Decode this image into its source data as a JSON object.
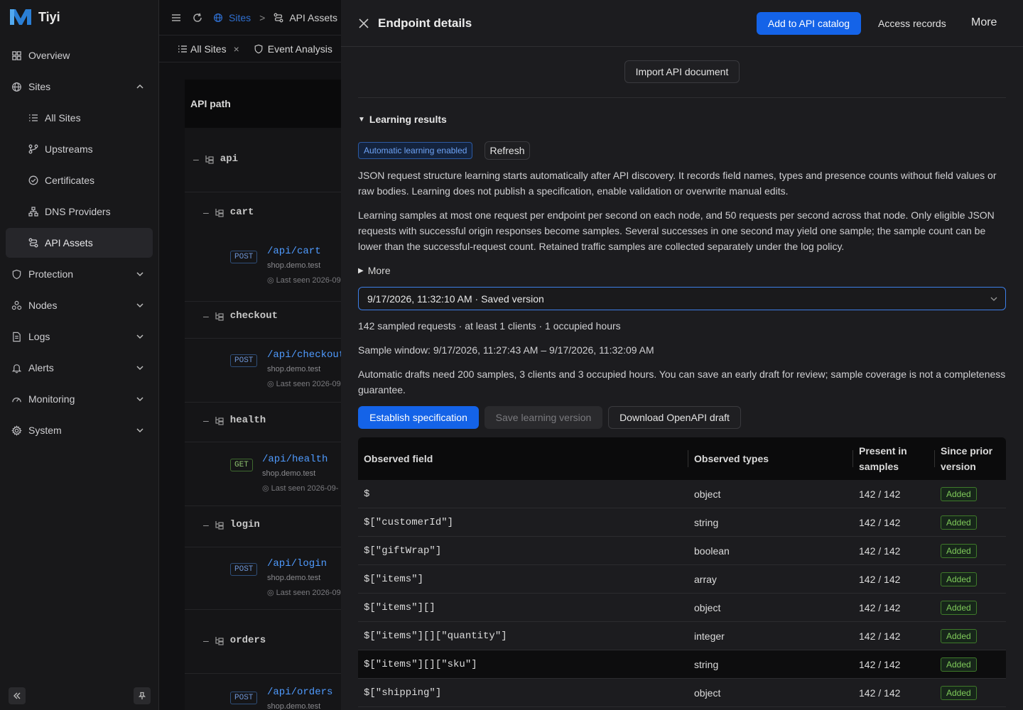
{
  "app": {
    "name": "Tiyi"
  },
  "sidebar": {
    "items": [
      {
        "label": "Overview",
        "icon": "grid-icon"
      },
      {
        "label": "Sites",
        "icon": "globe-icon",
        "expanded": true
      },
      {
        "label": "All Sites",
        "icon": "list-icon"
      },
      {
        "label": "Upstreams",
        "icon": "branch-icon"
      },
      {
        "label": "Certificates",
        "icon": "check-circle-icon"
      },
      {
        "label": "DNS Providers",
        "icon": "network-icon"
      },
      {
        "label": "API Assets",
        "icon": "api-icon",
        "active": true
      },
      {
        "label": "Protection",
        "icon": "shield-icon"
      },
      {
        "label": "Nodes",
        "icon": "nodes-icon"
      },
      {
        "label": "Logs",
        "icon": "document-icon"
      },
      {
        "label": "Alerts",
        "icon": "bell-icon"
      },
      {
        "label": "Monitoring",
        "icon": "gauge-icon"
      },
      {
        "label": "System",
        "icon": "gear-icon"
      }
    ]
  },
  "background": {
    "breadcrumb": {
      "sites": "Sites",
      "sep": ">",
      "api_assets": "API Assets"
    },
    "tabs": {
      "all_sites": "All Sites",
      "close": "×",
      "event_analysis": "Event Analysis"
    },
    "tree": {
      "header": "API path",
      "root": "api",
      "collapse_symbol": "–",
      "groups": [
        {
          "name": "cart",
          "method": "POST",
          "path": "/api/cart",
          "host": "shop.demo.test",
          "seen": "Last seen 2026-09"
        },
        {
          "name": "checkout",
          "method": "POST",
          "path": "/api/checkout",
          "host": "shop.demo.test",
          "seen": "Last seen 2026-09"
        },
        {
          "name": "health",
          "method": "GET",
          "path": "/api/health",
          "host": "shop.demo.test",
          "seen": "Last seen 2026-09-"
        },
        {
          "name": "login",
          "method": "POST",
          "path": "/api/login",
          "host": "shop.demo.test",
          "seen": "Last seen 2026-09"
        },
        {
          "name": "orders",
          "method": "POST",
          "path": "/api/orders",
          "host": "shop.demo.test",
          "seen": ""
        }
      ]
    }
  },
  "panel": {
    "title": "Endpoint details",
    "add_to_catalog": "Add to API catalog",
    "access_records": "Access records",
    "more": "More",
    "import_doc": "Import API document",
    "section_title": "Learning results",
    "auto_badge": "Automatic learning enabled",
    "refresh": "Refresh",
    "para1": "JSON request structure learning starts automatically after API discovery. It records field names, types and presence counts without field values or raw bodies. Learning does not publish a specification, enable validation or overwrite manual edits.",
    "para2": "Learning samples at most one request per endpoint per second on each node, and 50 requests per second across that node. Only eligible JSON requests with successful origin responses become samples. Several successes in one second may yield one sample; the sample count can be lower than the successful-request count. Retained traffic samples are collected separately under the log policy.",
    "more_toggle": "More",
    "version_select": "9/17/2026, 11:32:10 AM · Saved version",
    "stats": "142 sampled requests · at least 1 clients · 1 occupied hours",
    "window": "Sample window: 9/17/2026, 11:27:43 AM – 9/17/2026, 11:32:09 AM",
    "drafts_note": "Automatic drafts need 200 samples, 3 clients and 3 occupied hours. You can save an early draft for review; sample coverage is not a completeness guarantee.",
    "establish": "Establish specification",
    "save_version": "Save learning version",
    "download": "Download OpenAPI draft",
    "table": {
      "headers": {
        "field": "Observed field",
        "types": "Observed types",
        "present": "Present in samples",
        "since": "Since prior version"
      },
      "rows": [
        {
          "field": "$",
          "type": "object",
          "present": "142 / 142",
          "status": "Added"
        },
        {
          "field": "$[\"customerId\"]",
          "type": "string",
          "present": "142 / 142",
          "status": "Added"
        },
        {
          "field": "$[\"giftWrap\"]",
          "type": "boolean",
          "present": "142 / 142",
          "status": "Added"
        },
        {
          "field": "$[\"items\"]",
          "type": "array",
          "present": "142 / 142",
          "status": "Added"
        },
        {
          "field": "$[\"items\"][]",
          "type": "object",
          "present": "142 / 142",
          "status": "Added"
        },
        {
          "field": "$[\"items\"][][\"quantity\"]",
          "type": "integer",
          "present": "142 / 142",
          "status": "Added"
        },
        {
          "field": "$[\"items\"][][\"sku\"]",
          "type": "string",
          "present": "142 / 142",
          "status": "Added",
          "highlight": true
        },
        {
          "field": "$[\"shipping\"]",
          "type": "object",
          "present": "142 / 142",
          "status": "Added"
        }
      ]
    }
  }
}
